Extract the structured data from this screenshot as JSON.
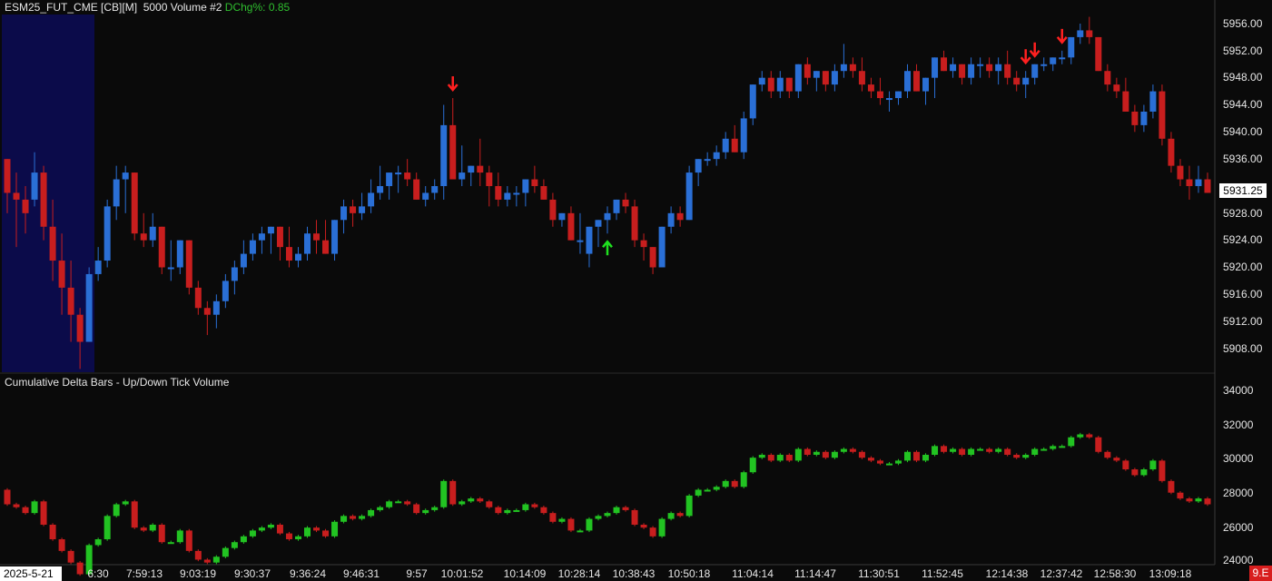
{
  "header": {
    "symbol": "ESM25_FUT_CME [CB][M]",
    "bar_type": "5000 Volume #2",
    "dchg_label": "DChg%:",
    "dchg_value": "0.85"
  },
  "price_axis": {
    "labels": [
      "5956.00",
      "5952.00",
      "5948.00",
      "5944.00",
      "5940.00",
      "5936.00",
      "5928.00",
      "5924.00",
      "5920.00",
      "5916.00",
      "5912.00",
      "5908.00"
    ],
    "last_price": "5931.25"
  },
  "delta_pane": {
    "label": "Cumulative Delta Bars - Up/Down Tick Volume",
    "axis_labels": [
      "34000",
      "32000",
      "30000",
      "28000",
      "26000",
      "24000"
    ]
  },
  "time_axis": {
    "date": "2025-5-21",
    "labels": [
      "6:30",
      "7:59:13",
      "9:03:19",
      "9:30:37",
      "9:36:24",
      "9:46:31",
      "9:57",
      "10:01:52",
      "10:14:09",
      "10:28:14",
      "10:38:43",
      "10:50:18",
      "11:04:14",
      "11:14:47",
      "11:30:51",
      "11:52:45",
      "12:14:38",
      "12:37:42",
      "12:58:30",
      "13:09:18"
    ]
  },
  "corner_badge": "9.E",
  "colors": {
    "background": "#0a0a0a",
    "up_candle": "#2a6fd6",
    "down_candle": "#c81e1e",
    "delta_up": "#22c322",
    "delta_down": "#c81e1e",
    "session_shade": "#0b0b4a",
    "buy_signal": "#1fe01f",
    "sell_signal": "#ff2020"
  },
  "chart_data": [
    {
      "type": "candlestick",
      "title": "ESM25_FUT_CME [CB][M]",
      "ylim": [
        5905,
        5958
      ],
      "candles": [
        [
          5936,
          5936,
          5928,
          5931
        ],
        [
          5931,
          5934,
          5923,
          5930
        ],
        [
          5930,
          5932,
          5925,
          5928
        ],
        [
          5930,
          5937,
          5929,
          5934
        ],
        [
          5934,
          5935,
          5924,
          5926
        ],
        [
          5926,
          5930,
          5918,
          5921
        ],
        [
          5921,
          5925,
          5913,
          5917
        ],
        [
          5917,
          5921,
          5909,
          5913
        ],
        [
          5913,
          5914,
          5905,
          5909
        ],
        [
          5909,
          5920,
          5909,
          5919
        ],
        [
          5919,
          5923,
          5918,
          5921
        ],
        [
          5921,
          5930,
          5920,
          5929
        ],
        [
          5929,
          5935,
          5927,
          5933
        ],
        [
          5933,
          5935,
          5928,
          5934
        ],
        [
          5934,
          5934,
          5924,
          5925
        ],
        [
          5925,
          5928,
          5923,
          5924
        ],
        [
          5924,
          5928,
          5923,
          5926
        ],
        [
          5926,
          5926,
          5919,
          5920
        ],
        [
          5920,
          5924,
          5918,
          5920
        ],
        [
          5920,
          5924,
          5919,
          5924
        ],
        [
          5924,
          5924,
          5916,
          5917
        ],
        [
          5917,
          5918,
          5913,
          5914
        ],
        [
          5914,
          5915,
          5910,
          5913
        ],
        [
          5913,
          5916,
          5911,
          5915
        ],
        [
          5915,
          5919,
          5914,
          5918
        ],
        [
          5918,
          5921,
          5916,
          5920
        ],
        [
          5920,
          5924,
          5919,
          5922
        ],
        [
          5922,
          5925,
          5921,
          5924
        ],
        [
          5924,
          5926,
          5922,
          5925
        ],
        [
          5925,
          5926,
          5922,
          5926
        ],
        [
          5926,
          5926,
          5921,
          5923
        ],
        [
          5923,
          5926,
          5920,
          5921
        ],
        [
          5921,
          5923,
          5920,
          5922
        ],
        [
          5922,
          5926,
          5921,
          5925
        ],
        [
          5925,
          5927,
          5922,
          5924
        ],
        [
          5924,
          5927,
          5922,
          5922
        ],
        [
          5922,
          5927,
          5921,
          5927
        ],
        [
          5927,
          5930,
          5925,
          5929
        ],
        [
          5929,
          5930,
          5926,
          5928
        ],
        [
          5928,
          5931,
          5927,
          5929
        ],
        [
          5929,
          5933,
          5928,
          5931
        ],
        [
          5931,
          5935,
          5930,
          5932
        ],
        [
          5932,
          5934,
          5930,
          5934
        ],
        [
          5934,
          5935,
          5931,
          5934
        ],
        [
          5934,
          5936,
          5932,
          5933
        ],
        [
          5933,
          5934,
          5930,
          5930
        ],
        [
          5930,
          5932,
          5929,
          5931
        ],
        [
          5931,
          5933,
          5930,
          5932
        ],
        [
          5932,
          5944,
          5930,
          5941
        ],
        [
          5941,
          5945,
          5934,
          5933
        ],
        [
          5933,
          5938,
          5932,
          5934
        ],
        [
          5934,
          5935,
          5932,
          5935
        ],
        [
          5935,
          5939,
          5932,
          5934
        ],
        [
          5934,
          5935,
          5929,
          5932
        ],
        [
          5932,
          5934,
          5929,
          5930
        ],
        [
          5930,
          5932,
          5929,
          5931
        ],
        [
          5931,
          5932,
          5929,
          5931
        ],
        [
          5931,
          5933,
          5929,
          5933
        ],
        [
          5933,
          5935,
          5931,
          5932
        ],
        [
          5932,
          5933,
          5930,
          5930
        ],
        [
          5930,
          5931,
          5926,
          5927
        ],
        [
          5927,
          5928,
          5926,
          5928
        ],
        [
          5928,
          5929,
          5924,
          5924
        ],
        [
          5924,
          5928,
          5922,
          5924
        ],
        [
          5922,
          5926,
          5920,
          5926
        ],
        [
          5926,
          5927,
          5923,
          5927
        ],
        [
          5927,
          5929,
          5925,
          5928
        ],
        [
          5928,
          5930,
          5927,
          5930
        ],
        [
          5930,
          5931,
          5928,
          5929
        ],
        [
          5929,
          5930,
          5923,
          5924
        ],
        [
          5924,
          5925,
          5921,
          5923
        ],
        [
          5923,
          5923,
          5919,
          5920
        ],
        [
          5920,
          5926,
          5920,
          5926
        ],
        [
          5926,
          5929,
          5925,
          5928
        ],
        [
          5928,
          5929,
          5926,
          5927
        ],
        [
          5927,
          5935,
          5927,
          5934
        ],
        [
          5934,
          5936,
          5932,
          5936
        ],
        [
          5936,
          5937,
          5935,
          5936
        ],
        [
          5936,
          5938,
          5935,
          5937
        ],
        [
          5937,
          5940,
          5936,
          5939
        ],
        [
          5939,
          5941,
          5937,
          5937
        ],
        [
          5937,
          5943,
          5936,
          5942
        ],
        [
          5942,
          5947,
          5941,
          5947
        ],
        [
          5947,
          5949,
          5946,
          5948
        ],
        [
          5948,
          5949,
          5945,
          5946
        ],
        [
          5946,
          5949,
          5945,
          5948
        ],
        [
          5948,
          5948,
          5945,
          5946
        ],
        [
          5946,
          5950,
          5945,
          5950
        ],
        [
          5950,
          5951,
          5947,
          5948
        ],
        [
          5948,
          5949,
          5946,
          5949
        ],
        [
          5949,
          5949,
          5946,
          5947
        ],
        [
          5947,
          5950,
          5946,
          5949
        ],
        [
          5949,
          5953,
          5948,
          5950
        ],
        [
          5950,
          5951,
          5948,
          5949
        ],
        [
          5949,
          5951,
          5946,
          5947
        ],
        [
          5947,
          5948,
          5945,
          5946
        ],
        [
          5946,
          5948,
          5944,
          5945
        ],
        [
          5945,
          5946,
          5943,
          5945
        ],
        [
          5945,
          5946,
          5944,
          5946
        ],
        [
          5946,
          5950,
          5945,
          5949
        ],
        [
          5949,
          5950,
          5946,
          5946
        ],
        [
          5946,
          5948,
          5944,
          5948
        ],
        [
          5948,
          5951,
          5945,
          5951
        ],
        [
          5951,
          5952,
          5949,
          5949
        ],
        [
          5949,
          5951,
          5948,
          5950
        ],
        [
          5950,
          5950,
          5947,
          5948
        ],
        [
          5948,
          5951,
          5947,
          5950
        ],
        [
          5950,
          5951,
          5948,
          5950
        ],
        [
          5950,
          5951,
          5948,
          5949
        ],
        [
          5949,
          5951,
          5947,
          5950
        ],
        [
          5950,
          5952,
          5947,
          5948
        ],
        [
          5948,
          5949,
          5946,
          5947
        ],
        [
          5947,
          5949,
          5945,
          5948
        ],
        [
          5948,
          5950,
          5947,
          5950
        ],
        [
          5950,
          5951,
          5949,
          5950
        ],
        [
          5950,
          5951,
          5949,
          5951
        ],
        [
          5951,
          5952,
          5950,
          5951
        ],
        [
          5951,
          5954,
          5950,
          5954
        ],
        [
          5954,
          5956,
          5953,
          5955
        ],
        [
          5955,
          5957,
          5953,
          5954
        ],
        [
          5954,
          5954,
          5949,
          5949
        ],
        [
          5949,
          5950,
          5946,
          5947
        ],
        [
          5947,
          5948,
          5945,
          5946
        ],
        [
          5946,
          5948,
          5943,
          5943
        ],
        [
          5943,
          5944,
          5940,
          5941
        ],
        [
          5941,
          5944,
          5940,
          5943
        ],
        [
          5943,
          5947,
          5942,
          5946
        ],
        [
          5946,
          5947,
          5938,
          5939
        ],
        [
          5939,
          5940,
          5934,
          5935
        ],
        [
          5935,
          5936,
          5932,
          5933
        ],
        [
          5933,
          5935,
          5930,
          5932
        ],
        [
          5932,
          5935,
          5931,
          5933
        ],
        [
          5933,
          5934,
          5931,
          5931
        ]
      ],
      "sell_signals": [
        49,
        112,
        113,
        116
      ],
      "buy_signals": [
        66
      ]
    },
    {
      "type": "candlestick",
      "title": "Cumulative Delta Bars - Up/Down Tick Volume",
      "ylim": [
        24000,
        34500
      ]
    }
  ]
}
